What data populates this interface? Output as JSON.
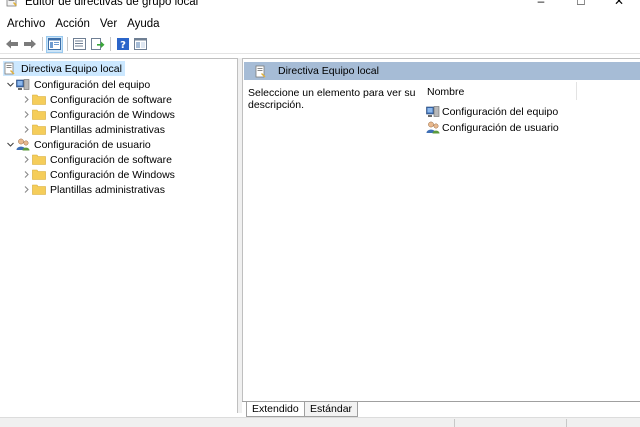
{
  "window": {
    "title": "Editor de directivas de grupo local",
    "minimize_glyph": "–",
    "maximize_glyph": "□",
    "close_glyph": "✕"
  },
  "menu": [
    "Archivo",
    "Acción",
    "Ver",
    "Ayuda"
  ],
  "toolbar": {
    "icons": [
      "back-arrow-icon",
      "forward-arrow-icon",
      "show-hide-tree-icon",
      "properties-icon",
      "export-list-icon",
      "help-icon",
      "extended-view-icon"
    ]
  },
  "tree": {
    "root": "Directiva Equipo local",
    "computer": {
      "label": "Configuración del equipo",
      "children": [
        "Configuración de software",
        "Configuración de Windows",
        "Plantillas administrativas"
      ]
    },
    "user": {
      "label": "Configuración de usuario",
      "children": [
        "Configuración de software",
        "Configuración de Windows",
        "Plantillas administrativas"
      ]
    }
  },
  "details": {
    "header": "Directiva Equipo local",
    "description": "Seleccione un elemento para ver su descripción.",
    "column_name": "Nombre",
    "items": [
      "Configuración del equipo",
      "Configuración de usuario"
    ]
  },
  "tabs": [
    "Extendido",
    "Estándar"
  ],
  "colors": {
    "header_band": "#a6bcd6",
    "selection": "#cce8ff",
    "folder": "#f5cd5a"
  }
}
